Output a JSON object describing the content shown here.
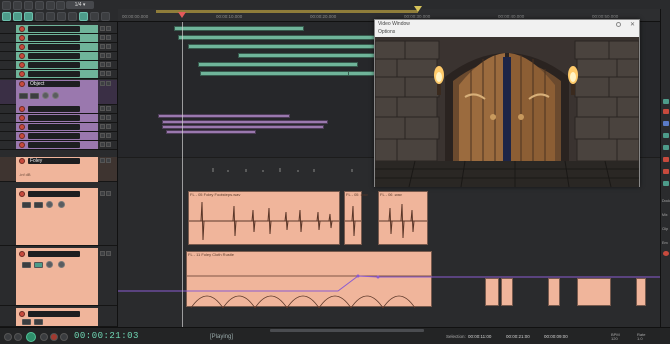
{
  "toolbar": {
    "grid_value": "1/4 ▾",
    "buttons": [
      "undo",
      "redo",
      "save",
      "snap",
      "grid",
      "metronome",
      "lock",
      "ripple",
      "trim",
      "envelope",
      "crossfade"
    ]
  },
  "ruler": {
    "labels": [
      "00:00:00.000",
      "00:00:10.000",
      "00:00:20.000",
      "00:00:30.000",
      "00:00:40.000",
      "00:00:50.000"
    ]
  },
  "tracks": {
    "object_name": "Object",
    "foley_name": "Foley",
    "foley_sub": "-inf dB"
  },
  "items": {
    "wave1_label": "FL - 05 Foley Footsteps.wav",
    "wave2_label": "FL - 05 .wav",
    "wave3_label": "FL - 06 .wav",
    "env_label": "FL - 11 Foley Cloth Rustle"
  },
  "video": {
    "title": "Video Window",
    "options": "Options",
    "close": "✕"
  },
  "transport": {
    "time": "00:00:21:03",
    "status": "[Playing]",
    "selection_label": "Selection:",
    "sel_start": "00:00:11:00",
    "sel_end": "00:00:21:00",
    "sel_len": "00:00:09:00",
    "bpm_label": "BPM",
    "bpm_value": "120",
    "rate_label": "Rate",
    "rate_value": "1.0"
  },
  "rpanel": {
    "labels": [
      "Dock",
      "Mix",
      "Clip",
      "Env"
    ]
  },
  "colors": {
    "accent_green": "#6fb49a",
    "accent_purple": "#9a78ae",
    "accent_peach": "#f0b59b",
    "time_text": "#6fd7b4",
    "record": "#c74a3d"
  }
}
